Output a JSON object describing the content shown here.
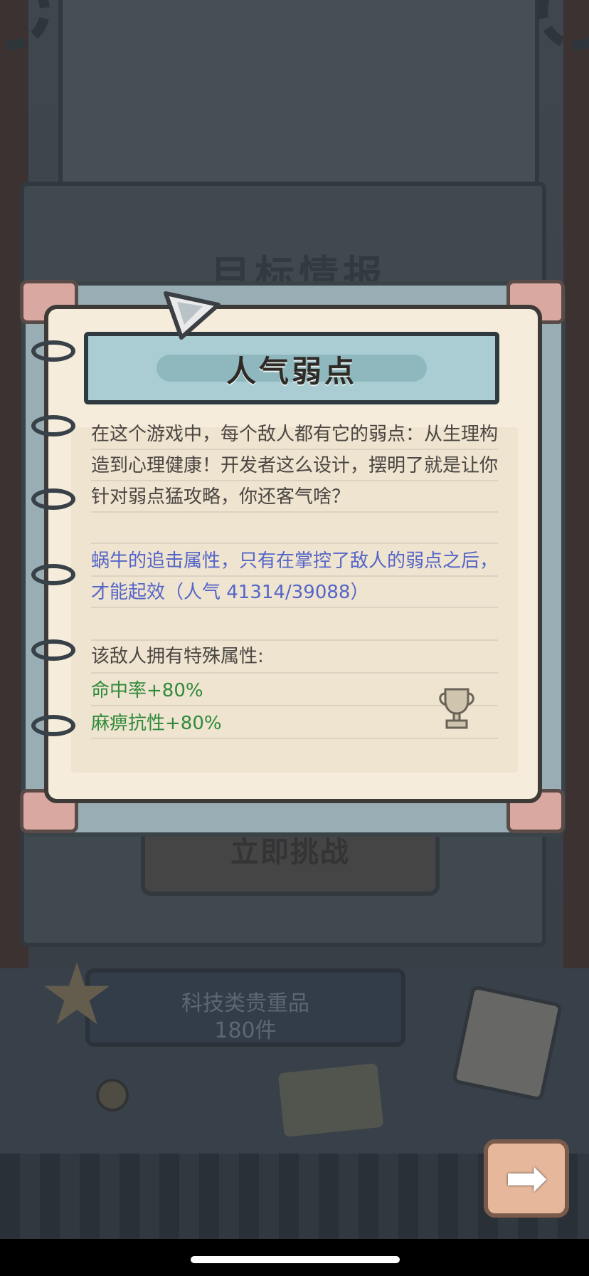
{
  "background": {
    "board_title": "目标情报",
    "challenge_button_label": "立即挑战",
    "plaque": {
      "line1": "科技类贵重品",
      "line2": "180件"
    }
  },
  "dialog": {
    "title": "人气弱点",
    "intro_text": "在这个游戏中，每个敌人都有它的弱点：从生理构造到心理健康！开发者这么设计，摆明了就是让你针对弱点猛攻略，你还客气啥？",
    "ability_text": "蜗牛的追击属性，只有在掌控了敌人的弱点之后，才能起效（人气 41314/39088）",
    "special_label": "该敌人拥有特殊属性:",
    "special_attributes": [
      "命中率+80%",
      "麻痹抗性+80%"
    ]
  },
  "icons": {
    "next": "arrow-right-icon",
    "trophy": "trophy-icon",
    "star": "star-icon",
    "calendar": "calendar-icon"
  },
  "colors": {
    "ability_text": "#5465c8",
    "attribute_text": "#2f8a3a",
    "banner": "#a9cdd3",
    "paper": "#f5ecdc"
  }
}
